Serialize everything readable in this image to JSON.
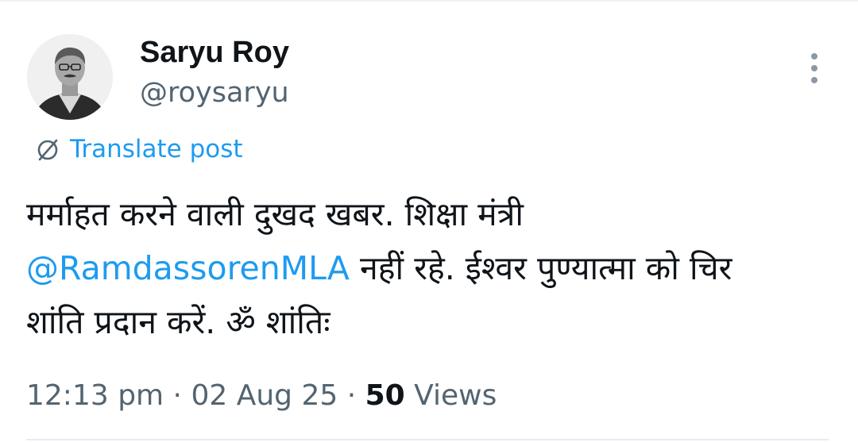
{
  "post": {
    "author": {
      "display_name": "Saryu Roy",
      "handle": "@roysaryu"
    },
    "translate_label": "Translate post",
    "text": {
      "line1": "मर्माहत करने वाली दुखद खबर. शिक्षा मंत्री",
      "mention": "@RamdassorenMLA",
      "line2_rest": " नहीं रहे. ईश्वर पुण्यात्मा को चिर",
      "line3": "शांति प्रदान करें. ॐ शांतिः"
    },
    "meta": {
      "time": "12:13 pm",
      "separator": " · ",
      "date": "02 Aug 25",
      "views_count": "50",
      "views_label": " Views"
    }
  },
  "icons": {
    "translate": "globe-slash-icon",
    "more": "more-vertical-icon"
  },
  "colors": {
    "link": "#1d9bf0",
    "text_primary": "#0f1419",
    "text_secondary": "#536471"
  }
}
